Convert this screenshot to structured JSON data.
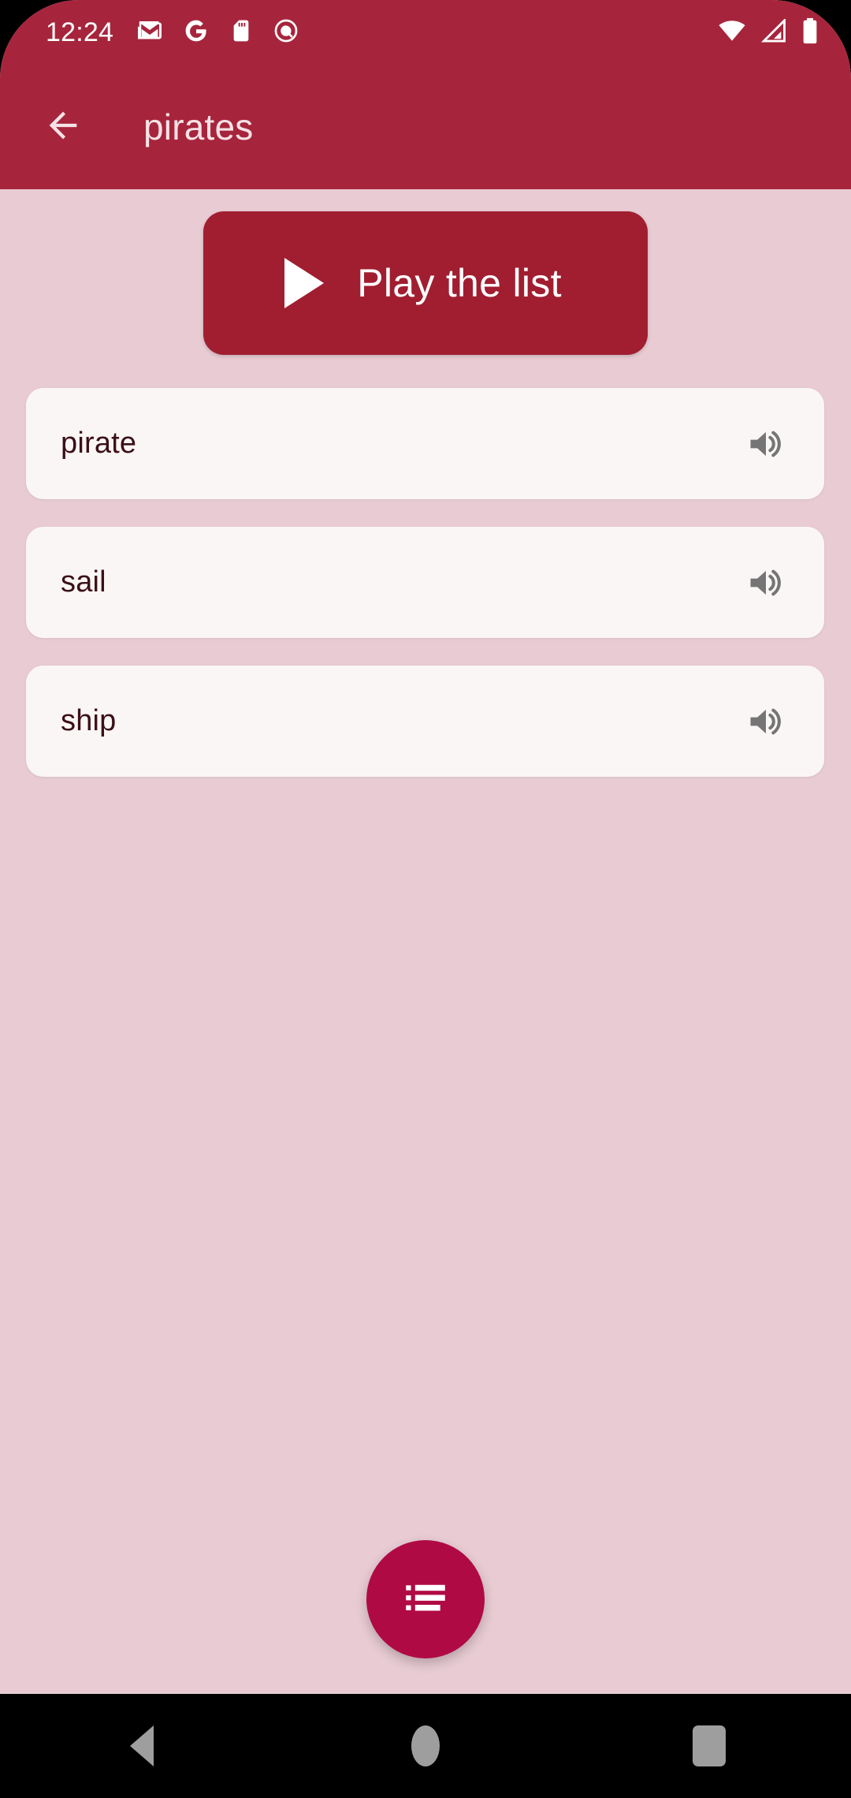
{
  "status_bar": {
    "time": "12:24",
    "left_icons": [
      "gmail-icon",
      "google-g-icon",
      "sd-card-icon",
      "assistant-q-icon"
    ],
    "right_icons": [
      "wifi-icon",
      "cellular-signal-icon",
      "battery-icon"
    ],
    "background_color": "#A6253C",
    "icon_color": "#FFFFFF"
  },
  "app_bar": {
    "back_label": "back-arrow",
    "title": "pirates",
    "background_color": "#A6253C",
    "title_color": "#F6E2E6"
  },
  "main": {
    "background_color": "#E8CBD3",
    "play_button": {
      "label": "Play the list",
      "icon": "play-triangle-icon",
      "background_color": "#A01E30",
      "text_color": "#FFFFFF"
    },
    "word_list": {
      "card_background": "#FBF6F6",
      "text_color": "#3A1018",
      "speaker_icon_color": "#757575",
      "items": [
        {
          "word": "pirate",
          "action_icon": "speaker-volume-up-icon"
        },
        {
          "word": "sail",
          "action_icon": "speaker-volume-up-icon"
        },
        {
          "word": "ship",
          "action_icon": "speaker-volume-up-icon"
        }
      ]
    },
    "fab": {
      "icon": "list-bulleted-icon",
      "background_color": "#B00A45",
      "icon_color": "#FFFFFF"
    }
  },
  "navigation_bar": {
    "background_color": "#000000",
    "icon_color": "#9E9E9E",
    "buttons": [
      {
        "name": "back",
        "icon": "nav-back-triangle-icon"
      },
      {
        "name": "home",
        "icon": "nav-home-circle-icon"
      },
      {
        "name": "recents",
        "icon": "nav-recents-square-icon"
      }
    ]
  }
}
